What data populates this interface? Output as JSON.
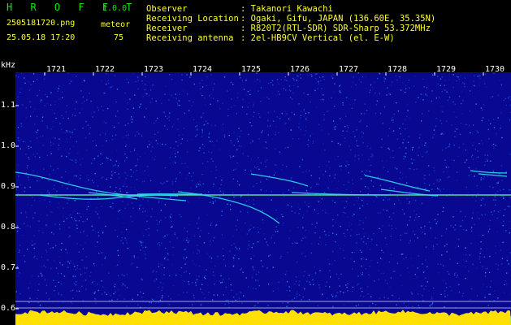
{
  "app": {
    "name": "H R O F F T",
    "version": "1.0.0",
    "filename": "2505181720.png",
    "datetime": "25.05.18 17:20",
    "meteor_label": "meteor",
    "meteor_count": "75"
  },
  "info": {
    "rows": [
      {
        "label": "Observer",
        "value": ": Takanori Kawachi"
      },
      {
        "label": "Receiving Location",
        "value": ": Ogaki, Gifu, JAPAN (136.60E, 35.35N)"
      },
      {
        "label": "Receiver",
        "value": ": R820T2(RTL-SDR) SDR-Sharp 53.372MHz"
      },
      {
        "label": "Receiving antenna",
        "value": ": 2el-HB9CV Vertical (el. E-W)"
      }
    ]
  },
  "axes": {
    "unit": "kHz",
    "time_ticks": [
      "1721",
      "1722",
      "1723",
      "1724",
      "1725",
      "1726",
      "1727",
      "1728",
      "1729",
      "1730"
    ],
    "freq_ticks": [
      "1.1",
      "1.0",
      "0.9",
      "0.8",
      "0.7",
      "0.6"
    ]
  },
  "colors": {
    "background": "#000000",
    "spectrum": "#080890",
    "title_green": "#19e619",
    "text_yellow": "#ffff33",
    "trace": "#33ddee",
    "carrier": "#66ff99",
    "baseline_fill": "#ffe000",
    "baseline_edge": "#22ccff"
  }
}
